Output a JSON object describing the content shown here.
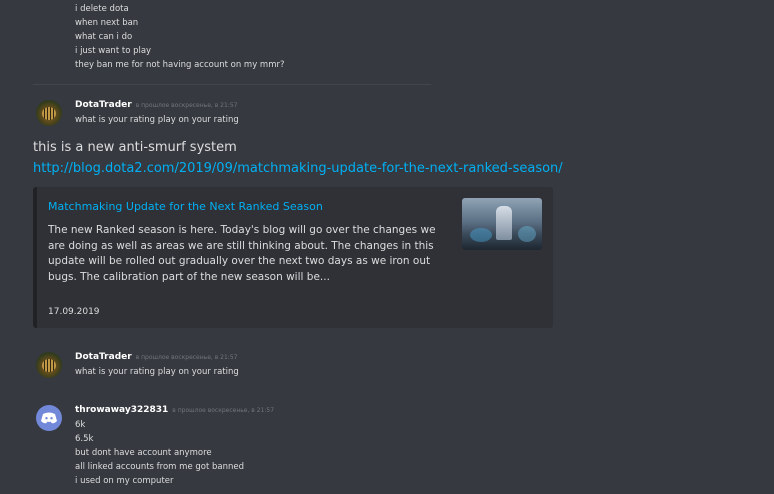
{
  "top_lines": [
    "i delete dota",
    "when next ban",
    "what can i do",
    "i just want to play",
    "they ban me for not having account on my mmr?"
  ],
  "msg1": {
    "username": "DotaTrader",
    "timestamp": "в прошлое воскресенье, в 21:57",
    "text": "what is your rating play on your rating"
  },
  "msg2": {
    "text": "this is a new anti-smurf system",
    "link": "http://blog.dota2.com/2019/09/matchmaking-update-for-the-next-ranked-season/"
  },
  "embed": {
    "title": "Matchmaking Update for the Next Ranked Season",
    "description": "The new Ranked season is here. Today's blog will go over the changes we are doing as well as areas we are still thinking about. The changes in this update will be rolled out gradually over the next two days as we iron out bugs. The calibration part of the new season will be...",
    "date": "17.09.2019"
  },
  "msg3": {
    "username": "DotaTrader",
    "timestamp": "в прошлое воскресенье, в 21:57",
    "text": "what is your rating play on your rating"
  },
  "msg4": {
    "username": "throwaway322831",
    "timestamp": "в прошлое воскресенье, в 21:57",
    "lines": [
      "6k",
      "6.5k",
      "but dont have account anymore",
      "all linked accounts from me got banned",
      "i used on my computer"
    ]
  },
  "colors": {
    "background": "#36393f",
    "link": "#00b0f4",
    "embed_bg": "#2f3136",
    "discord_blurple": "#7289da"
  }
}
